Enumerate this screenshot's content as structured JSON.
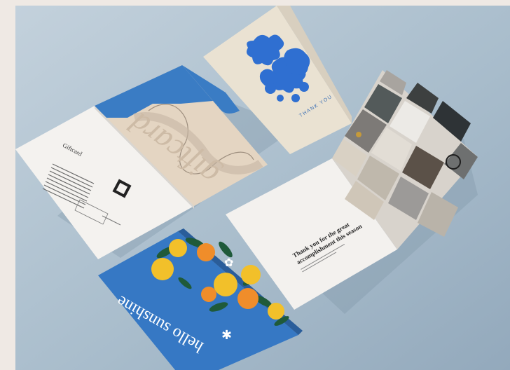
{
  "giftcard": {
    "cover_script": "giftcard",
    "inside_title": "Giftcard"
  },
  "thank_you_card": {
    "cover_text": "THANK YOU"
  },
  "photo_card": {
    "headline_line1": "Thank you for the great",
    "headline_line2": "accomplishment this season"
  },
  "sunshine_card": {
    "cover_text": "hello sunshine"
  },
  "colors": {
    "background": "#b2c4d2",
    "accent_blue": "#3f7fc8",
    "cream": "#e9e0d3",
    "lemon": "#f2c02a",
    "orange": "#f08d2a",
    "leaf": "#1f5a3a"
  }
}
